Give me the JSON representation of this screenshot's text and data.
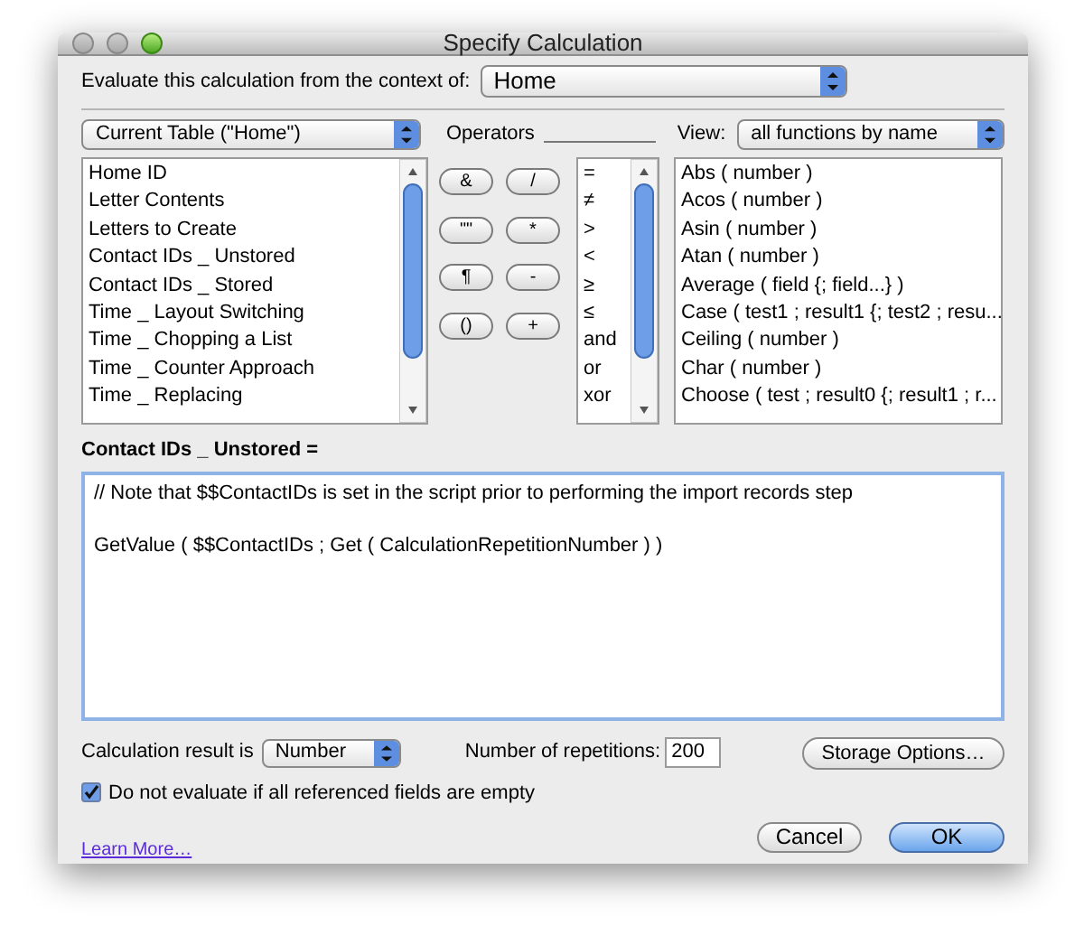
{
  "window": {
    "title": "Specify Calculation"
  },
  "context": {
    "label": "Evaluate this calculation from the context of:",
    "value": "Home"
  },
  "table_popup": {
    "value": "Current Table (\"Home\")"
  },
  "fields": [
    "Home ID",
    "Letter Contents",
    "Letters to Create",
    "Contact IDs _ Unstored",
    "Contact IDs _ Stored",
    "Time _ Layout Switching",
    "Time _ Chopping a List",
    "Time _ Counter Approach",
    "Time _ Replacing"
  ],
  "operators": {
    "label": "Operators",
    "buttons": [
      "&",
      "/",
      "\"\"",
      "*",
      "¶",
      "-",
      "()",
      "+"
    ],
    "list": [
      "=",
      "≠",
      ">",
      "<",
      "≥",
      "≤",
      "and",
      "or",
      "xor"
    ]
  },
  "view": {
    "label": "View:",
    "value": "all functions by name"
  },
  "functions": [
    "Abs ( number )",
    "Acos ( number )",
    "Asin ( number )",
    "Atan ( number )",
    "Average ( field {; field...} )",
    "Case ( test1 ; result1 {; test2 ; resu...",
    "Ceiling ( number )",
    "Char ( number )",
    "Choose ( test ; result0 {; result1 ; r..."
  ],
  "formula": {
    "label": "Contact IDs _ Unstored =",
    "lines": [
      "// Note that $$ContactIDs is set in the script prior to performing the import records step",
      "GetValue ( $$ContactIDs ; Get ( CalculationRepetitionNumber ) )"
    ]
  },
  "result": {
    "label": "Calculation result is",
    "value": "Number"
  },
  "repetitions": {
    "label": "Number of repetitions:",
    "value": "200"
  },
  "storage_button": "Storage Options…",
  "do_not_evaluate": {
    "label": "Do not evaluate if all referenced fields are empty",
    "checked": true
  },
  "learn_more": "Learn More…",
  "buttons": [
    {
      "label": "Cancel",
      "kind": "secondary"
    },
    {
      "label": "OK",
      "kind": "default"
    }
  ]
}
